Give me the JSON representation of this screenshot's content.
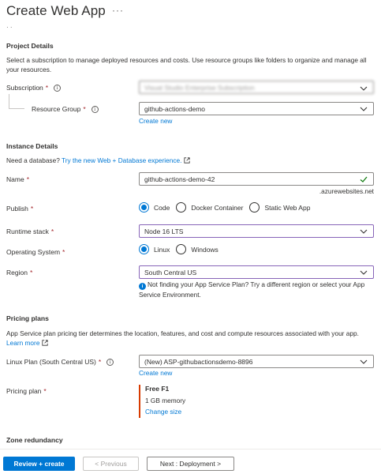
{
  "page": {
    "title": "Create Web App",
    "more": "···",
    "breadcrumb_stub": "·          ·"
  },
  "project": {
    "heading": "Project Details",
    "description": "Select a subscription to manage deployed resources and costs. Use resource groups like folders to organize and manage all your resources.",
    "subscription_label": "Subscription",
    "subscription_value": "Visual Studio Enterprise Subscription",
    "resource_group_label": "Resource Group",
    "resource_group_value": "github-actions-demo",
    "create_new": "Create new"
  },
  "instance": {
    "heading": "Instance Details",
    "db_prompt": "Need a database?",
    "db_link": "Try the new Web + Database experience.",
    "name_label": "Name",
    "name_value": "github-actions-demo-42",
    "name_suffix": ".azurewebsites.net",
    "publish_label": "Publish",
    "publish_options": [
      "Code",
      "Docker Container",
      "Static Web App"
    ],
    "publish_selected": "Code",
    "runtime_label": "Runtime stack",
    "runtime_value": "Node 16 LTS",
    "os_label": "Operating System",
    "os_options": [
      "Linux",
      "Windows"
    ],
    "os_selected": "Linux",
    "region_label": "Region",
    "region_value": "South Central US",
    "region_note": "Not finding your App Service Plan? Try a different region or select your App Service Environment."
  },
  "pricing": {
    "heading": "Pricing plans",
    "description": "App Service plan pricing tier determines the location, features, and cost and compute resources associated with your app.",
    "learn_more": "Learn more",
    "linux_plan_label": "Linux Plan (South Central US)",
    "linux_plan_value": "(New) ASP-githubactionsdemo-8896",
    "create_new": "Create new",
    "pricing_plan_label": "Pricing plan",
    "plan_name": "Free F1",
    "plan_memory": "1 GB memory",
    "change_size": "Change size"
  },
  "zone": {
    "heading": "Zone redundancy"
  },
  "footer": {
    "review_create": "Review + create",
    "previous": "< Previous",
    "next": "Next : Deployment >"
  },
  "required_mark": "*",
  "info_glyph": "i",
  "colors": {
    "accent": "#0078d4",
    "required": "#a4262c",
    "focus_border": "#8764b8",
    "valid_check": "#107c10",
    "plan_bar": "#d83b01"
  }
}
